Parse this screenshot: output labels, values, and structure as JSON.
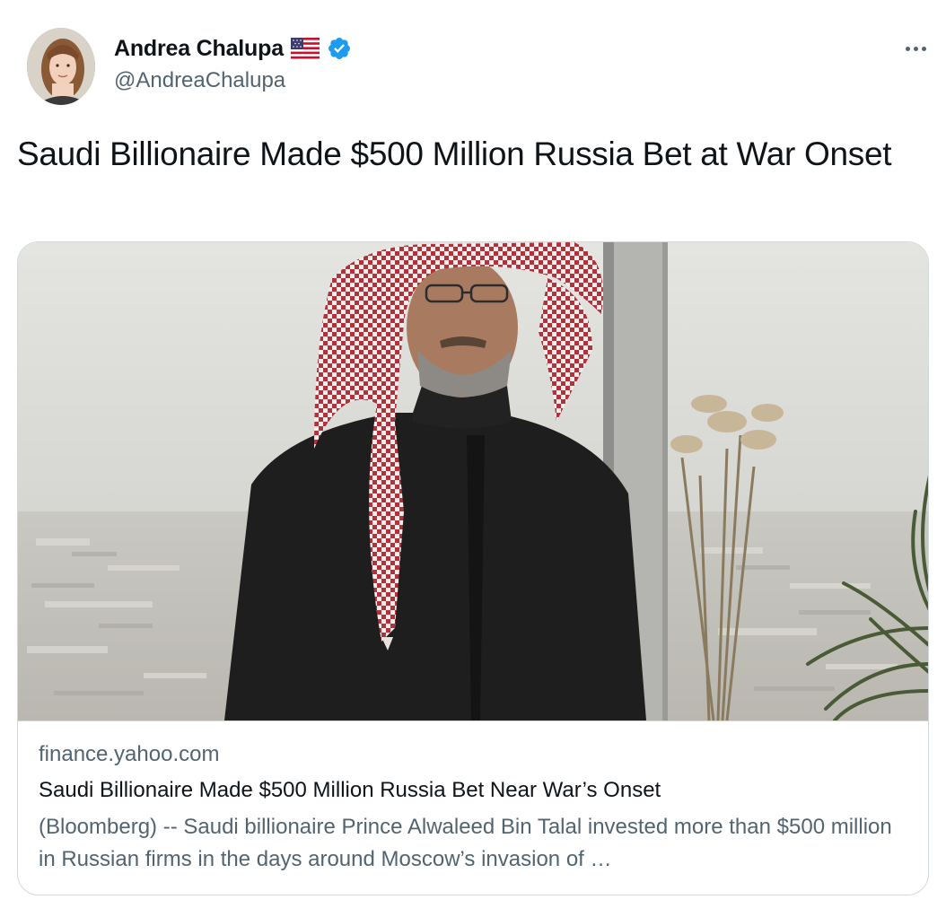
{
  "author": {
    "display_name": "Andrea Chalupa",
    "handle": "@AndreaChalupa",
    "flag_icon": "us-flag-icon",
    "verified_icon": "verified-badge-icon"
  },
  "tweet": {
    "text": "Saudi Billionaire Made $500 Million Russia Bet at War Onset"
  },
  "card": {
    "domain": "finance.yahoo.com",
    "title": "Saudi Billionaire Made $500 Million Russia Bet Near War’s Onset",
    "description": "(Bloomberg) -- Saudi billionaire Prince Alwaleed Bin Talal invested more than $500 million in Russian firms in the days around Moscow’s invasion of …"
  },
  "colors": {
    "text_primary": "#0f1419",
    "text_secondary": "#536471",
    "border": "#cfd9de",
    "verified_blue": "#1d9bf0"
  }
}
